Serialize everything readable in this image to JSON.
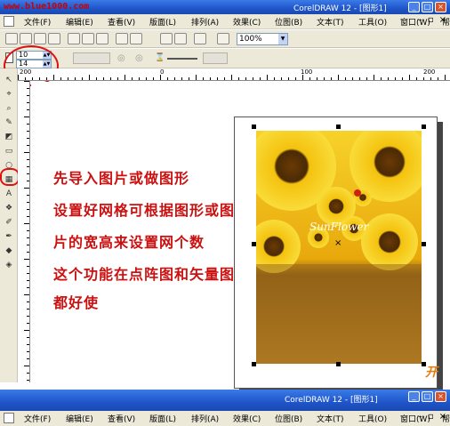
{
  "watermark": "www.blue1000.com",
  "window": {
    "title": "CorelDRAW 12 - [图形1]"
  },
  "menu": {
    "items": [
      "文件(F)",
      "编辑(E)",
      "查看(V)",
      "版面(L)",
      "排列(A)",
      "效果(C)",
      "位图(B)",
      "文本(T)",
      "工具(O)",
      "窗口(W)",
      "帮助(H)"
    ]
  },
  "toolbar": {
    "zoom": "100%"
  },
  "property_bar": {
    "rows": "10",
    "cols": "14"
  },
  "ruler": {
    "top_labels": [
      "200",
      "0",
      "100",
      "200"
    ]
  },
  "captions": [
    "先导入图片或做图形",
    "设置好网格可根据图形或图",
    "片的宽高来设置网个数",
    "这个功能在点阵图和矢量图里",
    "都好使"
  ],
  "photo": {
    "brand": "SunFlower"
  },
  "colors": {
    "caption": "#cc1010",
    "highlight": "#e01010",
    "titlebar": "#1f55c9"
  },
  "icons": [
    "pick-icon",
    "shape-icon",
    "zoom-icon",
    "freehand-icon",
    "smart-fill-icon",
    "rectangle-icon",
    "ellipse-icon",
    "graph-paper-icon",
    "text-icon",
    "interactive-icon",
    "eyedropper-icon",
    "outline-icon",
    "fill-icon"
  ]
}
